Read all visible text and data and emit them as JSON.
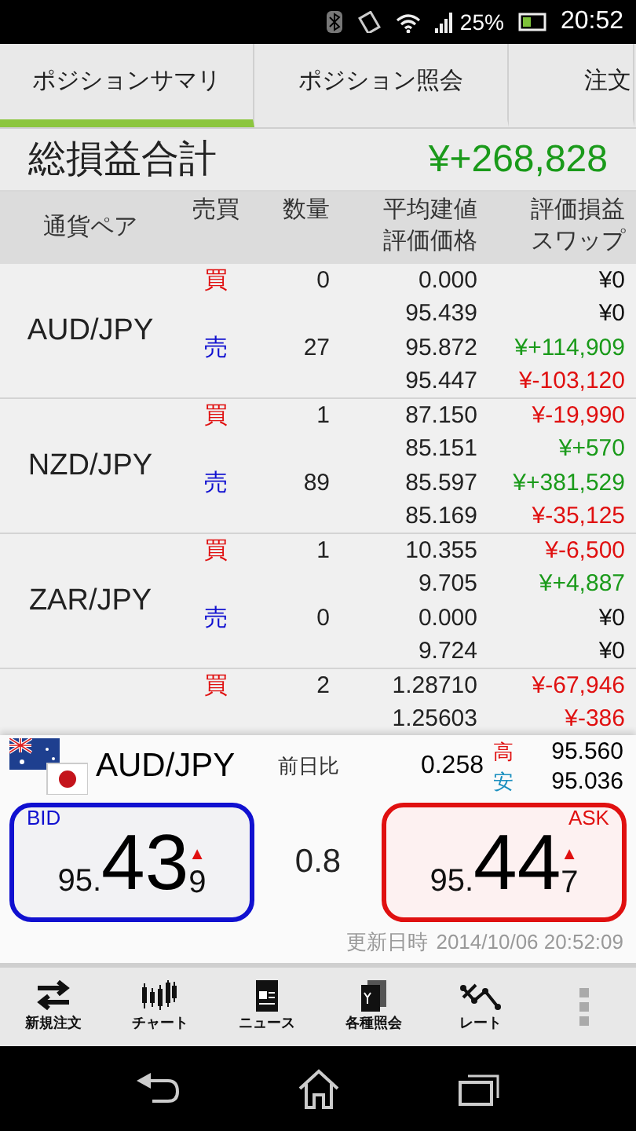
{
  "status_bar": {
    "battery": "25%",
    "time": "20:52"
  },
  "tabs": [
    {
      "label": "ポジションサマリ",
      "selected": true
    },
    {
      "label": "ポジション照会",
      "selected": false
    },
    {
      "label": "注文",
      "selected": false
    }
  ],
  "total": {
    "label": "総損益合計",
    "value": "¥+268,828",
    "color": "#1a9a1a"
  },
  "table": {
    "columns": [
      "通貨ペア",
      "売買",
      "数量",
      "平均建値",
      "評価価格",
      "評価損益",
      "スワップ"
    ],
    "groups": [
      {
        "pair": "AUD/JPY",
        "positions": [
          {
            "side": "買",
            "kind": "buy",
            "quantity": "0",
            "avg_price": "0.000",
            "eval_price": "95.439",
            "pl": {
              "text": "¥0",
              "color": "#111111"
            },
            "swap": {
              "text": "¥0",
              "color": "#111111"
            }
          },
          {
            "side": "売",
            "kind": "sell",
            "quantity": "27",
            "avg_price": "95.872",
            "eval_price": "95.447",
            "pl": {
              "text": "¥+114,909",
              "color": "#1a9a1a"
            },
            "swap": {
              "text": "¥-103,120",
              "color": "#e01010"
            }
          }
        ]
      },
      {
        "pair": "NZD/JPY",
        "positions": [
          {
            "side": "買",
            "kind": "buy",
            "quantity": "1",
            "avg_price": "87.150",
            "eval_price": "85.151",
            "pl": {
              "text": "¥-19,990",
              "color": "#e01010"
            },
            "swap": {
              "text": "¥+570",
              "color": "#1a9a1a"
            }
          },
          {
            "side": "売",
            "kind": "sell",
            "quantity": "89",
            "avg_price": "85.597",
            "eval_price": "85.169",
            "pl": {
              "text": "¥+381,529",
              "color": "#1a9a1a"
            },
            "swap": {
              "text": "¥-35,125",
              "color": "#e01010"
            }
          }
        ]
      },
      {
        "pair": "ZAR/JPY",
        "positions": [
          {
            "side": "買",
            "kind": "buy",
            "quantity": "1",
            "avg_price": "10.355",
            "eval_price": "9.705",
            "pl": {
              "text": "¥-6,500",
              "color": "#e01010"
            },
            "swap": {
              "text": "¥+4,887",
              "color": "#1a9a1a"
            }
          },
          {
            "side": "売",
            "kind": "sell",
            "quantity": "0",
            "avg_price": "0.000",
            "eval_price": "9.724",
            "pl": {
              "text": "¥0",
              "color": "#111111"
            },
            "swap": {
              "text": "¥0",
              "color": "#111111"
            }
          }
        ]
      },
      {
        "positions": [
          {
            "side": "買",
            "kind": "buy",
            "quantity": "2",
            "avg_price": "1.28710",
            "eval_price": "1.25603",
            "pl": {
              "text": "¥-67,946",
              "color": "#e01010"
            },
            "swap": {
              "text": "¥-386",
              "color": "#e01010"
            }
          }
        ]
      }
    ]
  },
  "quote": {
    "pair": "AUD/JPY",
    "change_label": "前日比",
    "change": "0.258",
    "high_label": "高",
    "high": "95.560",
    "low_label": "安",
    "low": "95.036",
    "bid": {
      "label": "BID",
      "prefix": "95.",
      "big": "43",
      "small": "9",
      "arrow": "▲"
    },
    "spread": "0.8",
    "ask": {
      "label": "ASK",
      "prefix": "95.",
      "big": "44",
      "small": "7",
      "arrow": "▲"
    },
    "updated_label": "更新日時",
    "updated": "2014/10/06 20:52:09"
  },
  "toolbar": [
    {
      "label": "新規注文",
      "kind": "swap"
    },
    {
      "label": "チャート",
      "kind": "chart"
    },
    {
      "label": "ニュース",
      "kind": "news"
    },
    {
      "label": "各種照会",
      "kind": "docs"
    },
    {
      "label": "レート",
      "kind": "rate"
    }
  ]
}
